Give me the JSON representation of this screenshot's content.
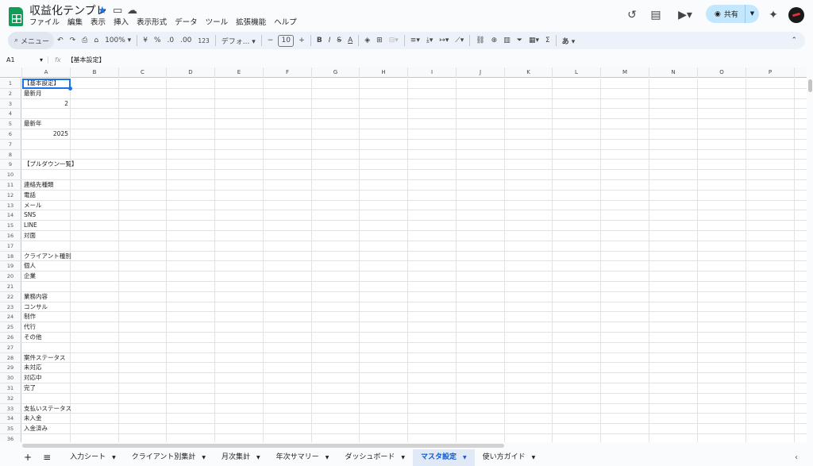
{
  "doc": {
    "title": "収益化テンプレ"
  },
  "menu": [
    "ファイル",
    "編集",
    "表示",
    "挿入",
    "表示形式",
    "データ",
    "ツール",
    "拡張機能",
    "ヘルプ"
  ],
  "header": {
    "share_label": "共有"
  },
  "toolbar": {
    "search_label": "メニュー",
    "zoom": "100%",
    "currency": "¥",
    "percent": "%",
    "dec_decrease": ".0",
    "dec_increase": ".00",
    "format_123": "123",
    "font": "デフォ...",
    "font_size": "10",
    "minus": "−",
    "plus": "+",
    "bold": "B",
    "italic": "I",
    "strike": "S",
    "textcolor": "A",
    "sigma": "Σ",
    "ime": "あ"
  },
  "formula_bar": {
    "cell_ref": "A1",
    "fx": "fx",
    "value": "【基本設定】"
  },
  "columns": [
    "A",
    "B",
    "C",
    "D",
    "E",
    "F",
    "G",
    "H",
    "I",
    "J",
    "K",
    "L",
    "M",
    "N",
    "O",
    "P"
  ],
  "rows": [
    {
      "n": "1",
      "a": "【基本設定】"
    },
    {
      "n": "2",
      "a": "最新月"
    },
    {
      "n": "3",
      "a": "2",
      "num": true
    },
    {
      "n": "4",
      "a": ""
    },
    {
      "n": "5",
      "a": "最新年"
    },
    {
      "n": "6",
      "a": "2025",
      "num": true
    },
    {
      "n": "7",
      "a": ""
    },
    {
      "n": "8",
      "a": ""
    },
    {
      "n": "9",
      "a": "【プルダウン一覧】"
    },
    {
      "n": "10",
      "a": ""
    },
    {
      "n": "11",
      "a": "連絡先種類"
    },
    {
      "n": "12",
      "a": "電話"
    },
    {
      "n": "13",
      "a": "メール"
    },
    {
      "n": "14",
      "a": "SNS"
    },
    {
      "n": "15",
      "a": "LINE"
    },
    {
      "n": "16",
      "a": "対面"
    },
    {
      "n": "17",
      "a": ""
    },
    {
      "n": "18",
      "a": "クライアント種別"
    },
    {
      "n": "19",
      "a": "個人"
    },
    {
      "n": "20",
      "a": "企業"
    },
    {
      "n": "21",
      "a": ""
    },
    {
      "n": "22",
      "a": "業務内容"
    },
    {
      "n": "23",
      "a": "コンサル"
    },
    {
      "n": "24",
      "a": "制作"
    },
    {
      "n": "25",
      "a": "代行"
    },
    {
      "n": "26",
      "a": "その他"
    },
    {
      "n": "27",
      "a": ""
    },
    {
      "n": "28",
      "a": "案件ステータス"
    },
    {
      "n": "29",
      "a": "未対応"
    },
    {
      "n": "30",
      "a": "対応中"
    },
    {
      "n": "31",
      "a": "完了"
    },
    {
      "n": "32",
      "a": ""
    },
    {
      "n": "33",
      "a": "支払いステータス"
    },
    {
      "n": "34",
      "a": "未入金"
    },
    {
      "n": "35",
      "a": "入金済み"
    },
    {
      "n": "36",
      "a": ""
    }
  ],
  "tabs": [
    {
      "label": "入力シート",
      "active": false
    },
    {
      "label": "クライアント別集計",
      "active": false
    },
    {
      "label": "月次集計",
      "active": false
    },
    {
      "label": "年次サマリー",
      "active": false
    },
    {
      "label": "ダッシュボード",
      "active": false
    },
    {
      "label": "マスタ設定",
      "active": true
    },
    {
      "label": "使い方ガイド",
      "active": false
    }
  ],
  "tabs_bar": {
    "add": "+",
    "all": "≡"
  }
}
